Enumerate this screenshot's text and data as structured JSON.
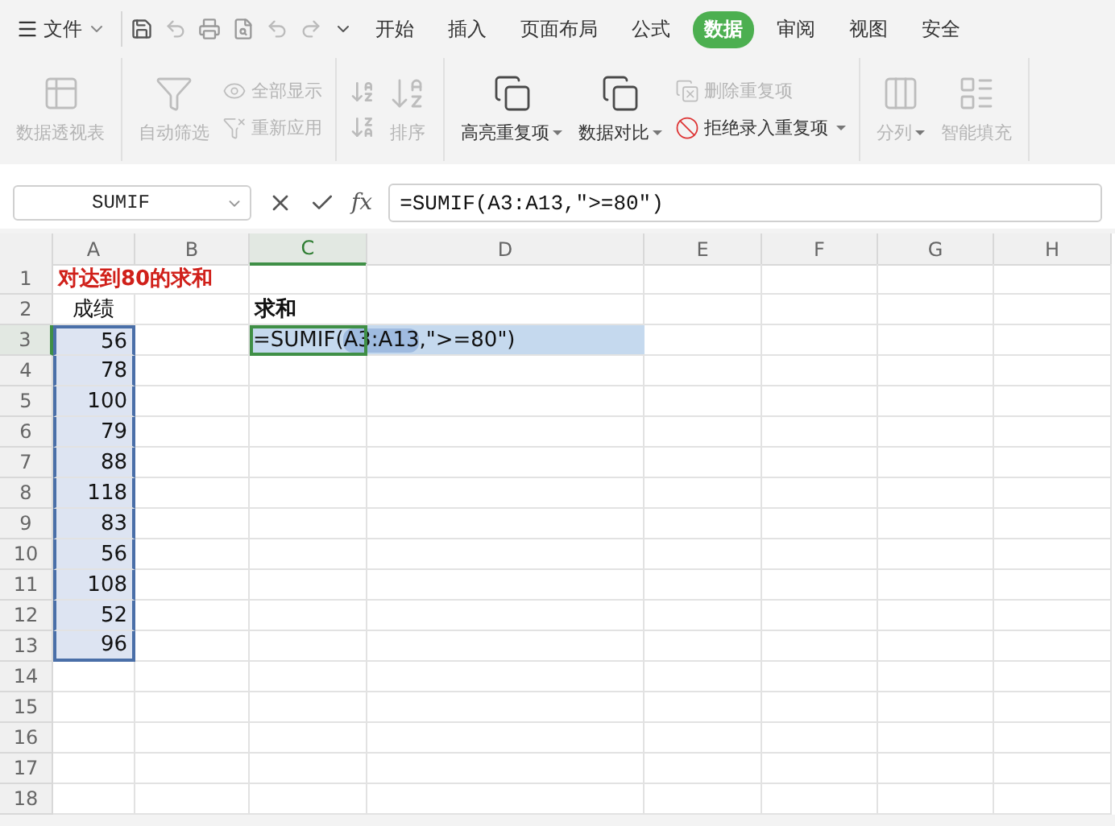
{
  "menu": {
    "file_label": "文件",
    "tabs": [
      {
        "label": "开始",
        "selected": false
      },
      {
        "label": "插入",
        "selected": false
      },
      {
        "label": "页面布局",
        "selected": false
      },
      {
        "label": "公式",
        "selected": false
      },
      {
        "label": "数据",
        "selected": true
      },
      {
        "label": "审阅",
        "selected": false
      },
      {
        "label": "视图",
        "selected": false
      },
      {
        "label": "安全",
        "selected": false
      }
    ]
  },
  "ribbon": {
    "groups": [
      [
        {
          "kind": "large",
          "label": "数据透视表",
          "disabled": true,
          "caret": false
        }
      ],
      [
        {
          "kind": "large",
          "label": "自动筛选",
          "disabled": true,
          "caret": false
        },
        {
          "kind": "stack",
          "items": [
            {
              "label": "全部显示",
              "disabled": true,
              "caret": false
            },
            {
              "label": "重新应用",
              "disabled": true,
              "caret": false
            }
          ]
        }
      ],
      [
        {
          "kind": "sort",
          "label": "排序",
          "disabled": true
        }
      ],
      [
        {
          "kind": "large",
          "label": "高亮重复项",
          "disabled": false,
          "caret": true
        },
        {
          "kind": "large",
          "label": "数据对比",
          "disabled": false,
          "caret": true
        },
        {
          "kind": "stack",
          "items": [
            {
              "label": "删除重复项",
              "disabled": true,
              "caret": false
            },
            {
              "label": "拒绝录入重复项",
              "disabled": false,
              "caret": true
            }
          ]
        }
      ],
      [
        {
          "kind": "large",
          "label": "分列",
          "disabled": true,
          "caret": true
        },
        {
          "kind": "large",
          "label": "智能填充",
          "disabled": true,
          "caret": false
        }
      ]
    ]
  },
  "formula_bar": {
    "name_box": "SUMIF",
    "function_label": "fx",
    "formula": "=SUMIF(A3:A13,″>=80″)"
  },
  "sheet": {
    "columns": [
      {
        "label": "A",
        "selected": false
      },
      {
        "label": "B",
        "selected": false
      },
      {
        "label": "C",
        "selected": true
      },
      {
        "label": "D",
        "selected": false
      },
      {
        "label": "E",
        "selected": false
      },
      {
        "label": "F",
        "selected": false
      },
      {
        "label": "G",
        "selected": false
      },
      {
        "label": "H",
        "selected": false
      }
    ],
    "rows": [
      {
        "number": "1",
        "selected": false,
        "cells": [
          {
            "kind": "title",
            "text": "对达到80的求和"
          },
          null,
          null,
          null,
          null,
          null,
          null,
          null
        ]
      },
      {
        "number": "2",
        "selected": false,
        "cells": [
          {
            "kind": "header",
            "text": "成绩"
          },
          null,
          {
            "kind": "bold",
            "text": "求和"
          },
          null,
          null,
          null,
          null,
          null
        ]
      },
      {
        "number": "3",
        "selected": true,
        "cells": [
          {
            "kind": "number",
            "text": "56",
            "in_range": true
          },
          null,
          {
            "kind": "editing",
            "parts": [
              {
                "text": "=SUMIF(",
                "highlight": false
              },
              {
                "text": "A3:A13",
                "highlight": true
              },
              {
                "text": ",\">=80\")",
                "highlight": false
              }
            ]
          },
          null,
          null,
          null,
          null,
          null
        ]
      },
      {
        "number": "4",
        "selected": false,
        "cells": [
          {
            "kind": "number",
            "text": "78",
            "in_range": true
          },
          null,
          null,
          null,
          null,
          null,
          null,
          null
        ]
      },
      {
        "number": "5",
        "selected": false,
        "cells": [
          {
            "kind": "number",
            "text": "100",
            "in_range": true
          },
          null,
          null,
          null,
          null,
          null,
          null,
          null
        ]
      },
      {
        "number": "6",
        "selected": false,
        "cells": [
          {
            "kind": "number",
            "text": "79",
            "in_range": true
          },
          null,
          null,
          null,
          null,
          null,
          null,
          null
        ]
      },
      {
        "number": "7",
        "selected": false,
        "cells": [
          {
            "kind": "number",
            "text": "88",
            "in_range": true
          },
          null,
          null,
          null,
          null,
          null,
          null,
          null
        ]
      },
      {
        "number": "8",
        "selected": false,
        "cells": [
          {
            "kind": "number",
            "text": "118",
            "in_range": true
          },
          null,
          null,
          null,
          null,
          null,
          null,
          null
        ]
      },
      {
        "number": "9",
        "selected": false,
        "cells": [
          {
            "kind": "number",
            "text": "83",
            "in_range": true
          },
          null,
          null,
          null,
          null,
          null,
          null,
          null
        ]
      },
      {
        "number": "10",
        "selected": false,
        "cells": [
          {
            "kind": "number",
            "text": "56",
            "in_range": true
          },
          null,
          null,
          null,
          null,
          null,
          null,
          null
        ]
      },
      {
        "number": "11",
        "selected": false,
        "cells": [
          {
            "kind": "number",
            "text": "108",
            "in_range": true
          },
          null,
          null,
          null,
          null,
          null,
          null,
          null
        ]
      },
      {
        "number": "12",
        "selected": false,
        "cells": [
          {
            "kind": "number",
            "text": "52",
            "in_range": true
          },
          null,
          null,
          null,
          null,
          null,
          null,
          null
        ]
      },
      {
        "number": "13",
        "selected": false,
        "cells": [
          {
            "kind": "number",
            "text": "96",
            "in_range": true
          },
          null,
          null,
          null,
          null,
          null,
          null,
          null
        ]
      },
      {
        "number": "14",
        "selected": false,
        "cells": [
          null,
          null,
          null,
          null,
          null,
          null,
          null,
          null
        ]
      },
      {
        "number": "15",
        "selected": false,
        "cells": [
          null,
          null,
          null,
          null,
          null,
          null,
          null,
          null
        ]
      },
      {
        "number": "16",
        "selected": false,
        "cells": [
          null,
          null,
          null,
          null,
          null,
          null,
          null,
          null
        ]
      },
      {
        "number": "17",
        "selected": false,
        "cells": [
          null,
          null,
          null,
          null,
          null,
          null,
          null,
          null
        ]
      },
      {
        "number": "18",
        "selected": false,
        "cells": [
          null,
          null,
          null,
          null,
          null,
          null,
          null,
          null
        ]
      }
    ]
  }
}
